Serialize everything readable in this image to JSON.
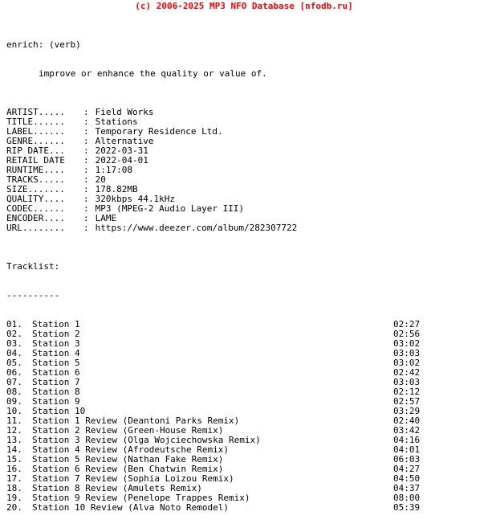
{
  "banner": {
    "text": "(c) 2006-2025 MP3 NFO Database [nfodb.ru]",
    "color": "#ff0000"
  },
  "definition": {
    "term": "enrich: (verb)",
    "body": "improve or enhance the quality or value of."
  },
  "metadata": [
    {
      "key": "ARTIST.....",
      "sep": ":",
      "value": "Field Works"
    },
    {
      "key": "TITLE......",
      "sep": ":",
      "value": "Stations"
    },
    {
      "key": "LABEL......",
      "sep": ":",
      "value": "Temporary Residence Ltd."
    },
    {
      "key": "GENRE......",
      "sep": ":",
      "value": "Alternative"
    },
    {
      "key": "RIP DATE...",
      "sep": ":",
      "value": "2022-03-31"
    },
    {
      "key": "RETAIL DATE",
      "sep": ":",
      "value": "2022-04-01"
    },
    {
      "key": "RUNTIME....",
      "sep": ":",
      "value": "1:17:08"
    },
    {
      "key": "TRACKS.....",
      "sep": ":",
      "value": "20"
    },
    {
      "key": "SIZE.......",
      "sep": ":",
      "value": "178.82MB"
    },
    {
      "key": "QUALITY....",
      "sep": ":",
      "value": "320kbps 44.1kHz"
    },
    {
      "key": "CODEC......",
      "sep": ":",
      "value": "MP3 (MPEG-2 Audio Layer III)"
    },
    {
      "key": "ENCODER....",
      "sep": ":",
      "value": "LAME"
    },
    {
      "key": "URL........",
      "sep": ":",
      "value": "https://www.deezer.com/album/282307722"
    }
  ],
  "tracklist": {
    "heading": "Tracklist:",
    "rule": "----------",
    "tracks": [
      {
        "num": "01.",
        "title": "Station 1",
        "time": "02:27"
      },
      {
        "num": "02.",
        "title": "Station 2",
        "time": "02:56"
      },
      {
        "num": "03.",
        "title": "Station 3",
        "time": "03:02"
      },
      {
        "num": "04.",
        "title": "Station 4",
        "time": "03:03"
      },
      {
        "num": "05.",
        "title": "Station 5",
        "time": "03:02"
      },
      {
        "num": "06.",
        "title": "Station 6",
        "time": "02:42"
      },
      {
        "num": "07.",
        "title": "Station 7",
        "time": "03:03"
      },
      {
        "num": "08.",
        "title": "Station 8",
        "time": "02:12"
      },
      {
        "num": "09.",
        "title": "Station 9",
        "time": "02:57"
      },
      {
        "num": "10.",
        "title": "Station 10",
        "time": "03:29"
      },
      {
        "num": "11.",
        "title": "Station 1 Review (Deantoni Parks Remix)",
        "time": "02:40"
      },
      {
        "num": "12.",
        "title": "Station 2 Review (Green-House Remix)",
        "time": "03:42"
      },
      {
        "num": "13.",
        "title": "Station 3 Review (Olga Wojciechowska Remix)",
        "time": "04:16"
      },
      {
        "num": "14.",
        "title": "Station 4 Review (Afrodeutsche Remix)",
        "time": "04:01"
      },
      {
        "num": "15.",
        "title": "Station 5 Review (Nathan Fake Remix)",
        "time": "06:03"
      },
      {
        "num": "16.",
        "title": "Station 6 Review (Ben Chatwin Remix)",
        "time": "04:27"
      },
      {
        "num": "17.",
        "title": "Station 7 Review (Sophia Loizou Remix)",
        "time": "04:50"
      },
      {
        "num": "18.",
        "title": "Station 8 Review (Amulets Remix)",
        "time": "04:37"
      },
      {
        "num": "19.",
        "title": "Station 9 Review (Penelope Trappes Remix)",
        "time": "08:00"
      },
      {
        "num": "20.",
        "title": "Station 10 Review (Alva Noto Remodel)",
        "time": "05:39"
      }
    ]
  }
}
